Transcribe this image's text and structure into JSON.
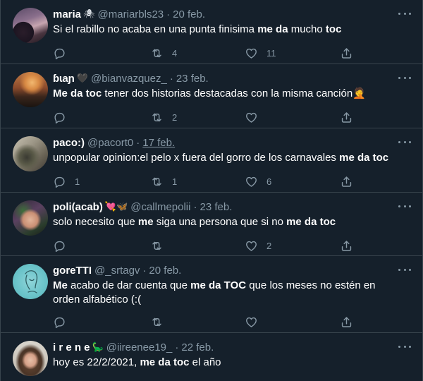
{
  "tweets": [
    {
      "name": "maria",
      "emoji": "🕷",
      "handle": "@mariarbls23",
      "date": "20 feb.",
      "date_underlined": false,
      "segments": [
        {
          "t": "Si el rabillo no acaba en una punta finisima ",
          "b": false
        },
        {
          "t": "me da",
          "b": true
        },
        {
          "t": " mucho ",
          "b": false
        },
        {
          "t": "toc",
          "b": true
        }
      ],
      "replies": "",
      "retweets": "4",
      "likes": "11"
    },
    {
      "name": "ɓɩaɲ",
      "emoji": "🖤",
      "handle": "@bianvazquez_",
      "date": "23 feb.",
      "date_underlined": false,
      "segments": [
        {
          "t": "Me da toc",
          "b": true
        },
        {
          "t": " tener dos historias destacadas con la misma canción",
          "b": false
        },
        {
          "t": "🤦",
          "b": false
        }
      ],
      "replies": "",
      "retweets": "2",
      "likes": ""
    },
    {
      "name": "paco:)",
      "emoji": "",
      "handle": "@pacort0",
      "date": "17 feb.",
      "date_underlined": true,
      "segments": [
        {
          "t": "unpopular opinion:el pelo x fuera del gorro de los carnavales ",
          "b": false
        },
        {
          "t": "me da toc",
          "b": true
        }
      ],
      "replies": "1",
      "retweets": "1",
      "likes": "6"
    },
    {
      "name": "poli(acab)",
      "emoji": "💘🦋",
      "handle": "@callmepolii",
      "date": "23 feb.",
      "date_underlined": false,
      "segments": [
        {
          "t": "solo necesito que ",
          "b": false
        },
        {
          "t": "me",
          "b": true
        },
        {
          "t": " siga una persona que si no ",
          "b": false
        },
        {
          "t": "me da toc",
          "b": true
        }
      ],
      "replies": "",
      "retweets": "",
      "likes": "2"
    },
    {
      "name": "goreTTI",
      "emoji": "",
      "handle": "@_srtagv",
      "date": "20 feb.",
      "date_underlined": false,
      "segments": [
        {
          "t": "Me",
          "b": true
        },
        {
          "t": " acabo de dar cuenta que ",
          "b": false
        },
        {
          "t": "me da TOC",
          "b": true
        },
        {
          "t": " que los meses no estén en orden alfabético (:(",
          "b": false
        }
      ],
      "replies": "",
      "retweets": "",
      "likes": ""
    },
    {
      "name": "i r e n e",
      "emoji": "🦕",
      "handle": "@iireenee19_",
      "date": "22 feb.",
      "date_underlined": false,
      "segments": [
        {
          "t": "hoy es 22/2/2021, ",
          "b": false
        },
        {
          "t": "me da toc",
          "b": true
        },
        {
          "t": " el año",
          "b": false
        }
      ],
      "replies": "",
      "retweets": "",
      "likes": ""
    }
  ],
  "colors": {
    "background": "#15202b",
    "border": "#38444d",
    "muted_text": "#8899a6",
    "primary_text": "#ffffff"
  },
  "icons": {
    "reply": "reply-icon",
    "retweet": "retweet-icon",
    "like": "heart-icon",
    "share": "share-icon",
    "more": "more-options-icon"
  }
}
